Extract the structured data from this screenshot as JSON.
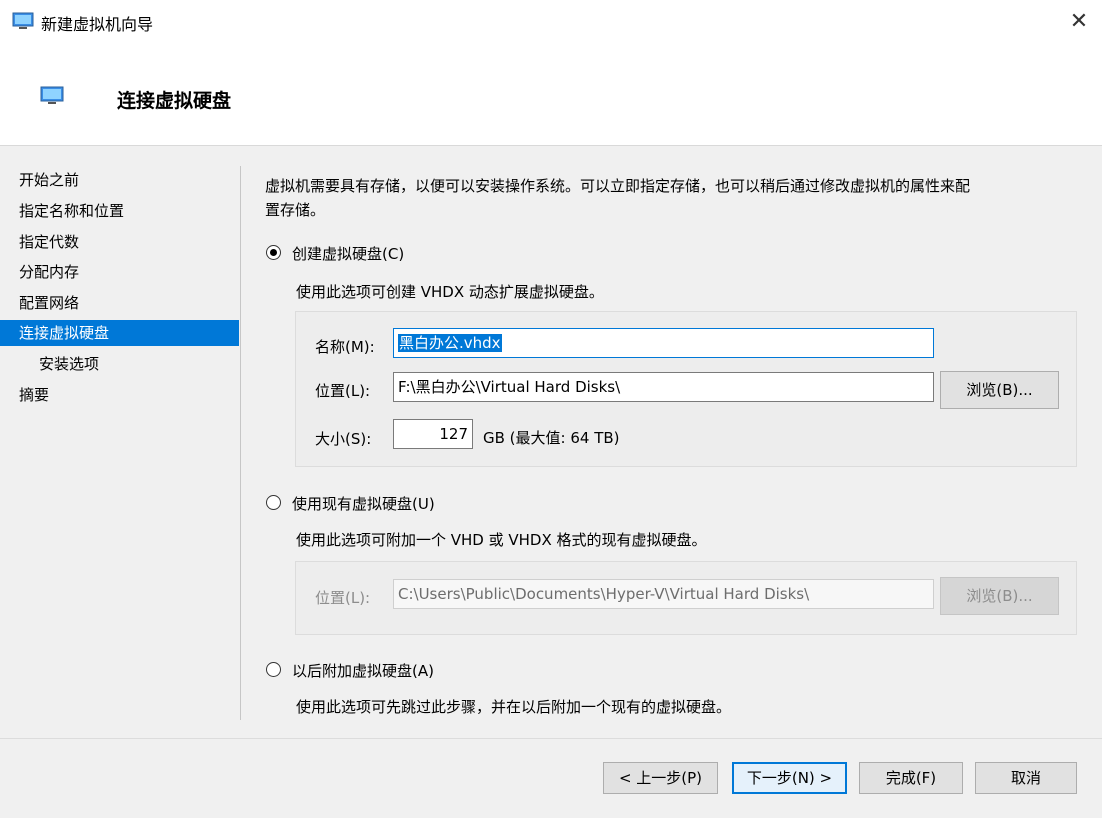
{
  "window": {
    "title": "新建虚拟机向导"
  },
  "header": {
    "title": "连接虚拟硬盘"
  },
  "nav": {
    "items": [
      "开始之前",
      "指定名称和位置",
      "指定代数",
      "分配内存",
      "配置网络",
      "连接虚拟硬盘",
      "安装选项",
      "摘要"
    ],
    "selected_index": 5
  },
  "intro": "虚拟机需要具有存储，以便可以安装操作系统。可以立即指定存储，也可以稍后通过修改虚拟机的属性来配置存储。",
  "intro_line1": "虚拟机需要具有存储，以便可以安装操作系统。可以立即指定存储，也可以稍后通过修改虚拟机的属性来配",
  "intro_line2": "置存储。",
  "option_create": {
    "label": "创建虚拟硬盘(C)",
    "desc": "使用此选项可创建 VHDX 动态扩展虚拟硬盘。",
    "selected": true,
    "name_label": "名称(M):",
    "name_value": "黑白办公.vhdx",
    "location_label": "位置(L):",
    "location_value": "F:\\黑白办公\\Virtual Hard Disks\\",
    "browse_label": "浏览(B)...",
    "size_label": "大小(S):",
    "size_value": "127",
    "size_unit": "GB (最大值: 64 TB)"
  },
  "option_existing": {
    "label": "使用现有虚拟硬盘(U)",
    "desc": "使用此选项可附加一个 VHD 或 VHDX 格式的现有虚拟硬盘。",
    "selected": false,
    "location_label": "位置(L):",
    "location_value": "C:\\Users\\Public\\Documents\\Hyper-V\\Virtual Hard Disks\\",
    "browse_label": "浏览(B)..."
  },
  "option_later": {
    "label": "以后附加虚拟硬盘(A)",
    "desc": "使用此选项可先跳过此步骤，并在以后附加一个现有的虚拟硬盘。",
    "selected": false
  },
  "footer": {
    "prev": "< 上一步(P)",
    "next": "下一步(N) >",
    "finish": "完成(F)",
    "cancel": "取消"
  },
  "colors": {
    "accent": "#0078d7"
  }
}
